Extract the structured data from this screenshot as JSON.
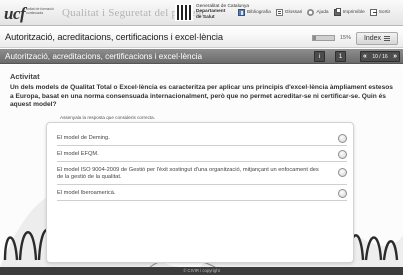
{
  "header": {
    "logo_text": "ucf",
    "logo_subtext": "unitat de formació continuada",
    "app_title": "Qualitat i Seguretat del pacient",
    "gencat_line1": "Generalitat de Catalunya",
    "gencat_line2": "Departament",
    "gencat_line3": "de Salut",
    "links": [
      {
        "label": "Bibliografia",
        "icon": "book-icon"
      },
      {
        "label": "Glossari",
        "icon": "glossary-icon"
      },
      {
        "label": "Ajuda",
        "icon": "help-icon"
      },
      {
        "label": "Imprimible",
        "icon": "print-icon"
      },
      {
        "label": "Sortir",
        "icon": "exit-icon"
      }
    ]
  },
  "titlebar": {
    "module_title": "Autorització, acreditacions, certificacions i excel·lència",
    "progress_fraction": 0.15,
    "progress_label": "15%",
    "index_label": "Index"
  },
  "sectionbar": {
    "section_title": "Autorització, acreditacions, certificacions i excel·lència",
    "btn_1": "i",
    "btn_2": "1",
    "pager_label": "10 / 16"
  },
  "activity": {
    "label": "Activitat",
    "question": "Un dels models de Qualitat Total o Excel·lència es caracteritza per aplicar uns principis d'excel·lència àmpliament estesos a Europa, basat en una norma consensuada internacionalment, però que no permet acreditar-se ni certificar-se. Quin és aquest model?",
    "instruction": "Assenyala la resposta que consideris correcta.",
    "answers": [
      "El model de Deming.",
      "El model EFQM.",
      "El model ISO 9004-2009 de Gestió per l'èxit sostingut d'una organització, mitjançant un enfocament des de la gestió de la qualitat.",
      "El model Iberoamericà."
    ]
  },
  "footer": {
    "text": "© CIVIR i copyright"
  },
  "colors": {
    "section_bar": "#777777",
    "footer": "#3c3c3c"
  }
}
